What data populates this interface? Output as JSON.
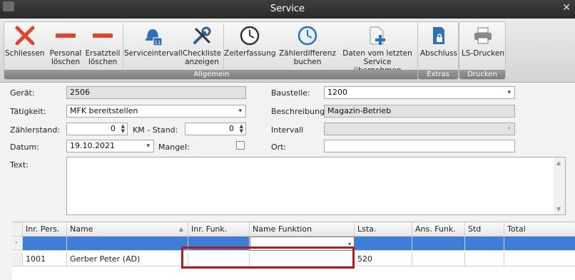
{
  "window": {
    "title": "Service"
  },
  "ribbon": {
    "groups": [
      {
        "label": "Allgemein"
      },
      {
        "label": "Extras"
      },
      {
        "label": "Drucken"
      }
    ],
    "buttons": {
      "schliessen": "Schliessen",
      "personal_line1": "Personal",
      "personal_line2": "löschen",
      "ersatzteil_line1": "Ersatzteil",
      "ersatzteil_line2": "löschen",
      "serviceintervall": "Serviceintervall",
      "checkliste_line1": "Checkliste",
      "checkliste_line2": "anzeigen",
      "zeiterfassung": "Zeiterfassung",
      "zaehler_line1": "Zählerdifferenz",
      "zaehler_line2": "buchen",
      "daten_line1": "Daten vom letzten",
      "daten_line2": "Service übernehmen",
      "abschluss": "Abschluss",
      "ls_drucken": "LS-Drucken"
    }
  },
  "form": {
    "geraet_label": "Gerät:",
    "geraet_value": "2506",
    "baustelle_label": "Baustelle:",
    "baustelle_value": "1200",
    "taetigkeit_label": "Tätigkeit:",
    "taetigkeit_value": "MFK bereitstellen",
    "beschreibung_label": "Beschreibung",
    "beschreibung_value": "Magazin-Betrieb",
    "zaehlerstand_label": "Zählerstand:",
    "zaehlerstand_value": "0",
    "km_label": "KM - Stand:",
    "km_value": "0",
    "intervall_label": "Intervall",
    "intervall_value": "",
    "datum_label": "Datum:",
    "datum_value": "19.10.2021",
    "mangel_label": "Mangel:",
    "ort_label": "Ort:",
    "ort_value": "",
    "text_label": "Text:"
  },
  "grid": {
    "columns": [
      "Inr. Pers.",
      "Name",
      "Inr. Funk.",
      "Name Funktion",
      "Lsta.",
      "Ans. Funk.",
      "Std",
      "Total"
    ],
    "rows": [
      {
        "inr_pers": "1001",
        "name": "Gerber Peter (AD)",
        "inr_funk": "",
        "name_funktion": "",
        "lsta": "520",
        "ans_funk": "",
        "std": "",
        "total": ""
      }
    ]
  },
  "colors": {
    "titlebar": "#2f2f2f",
    "selected_row": "#3d7fd6",
    "highlight_box": "#b21c1c"
  }
}
